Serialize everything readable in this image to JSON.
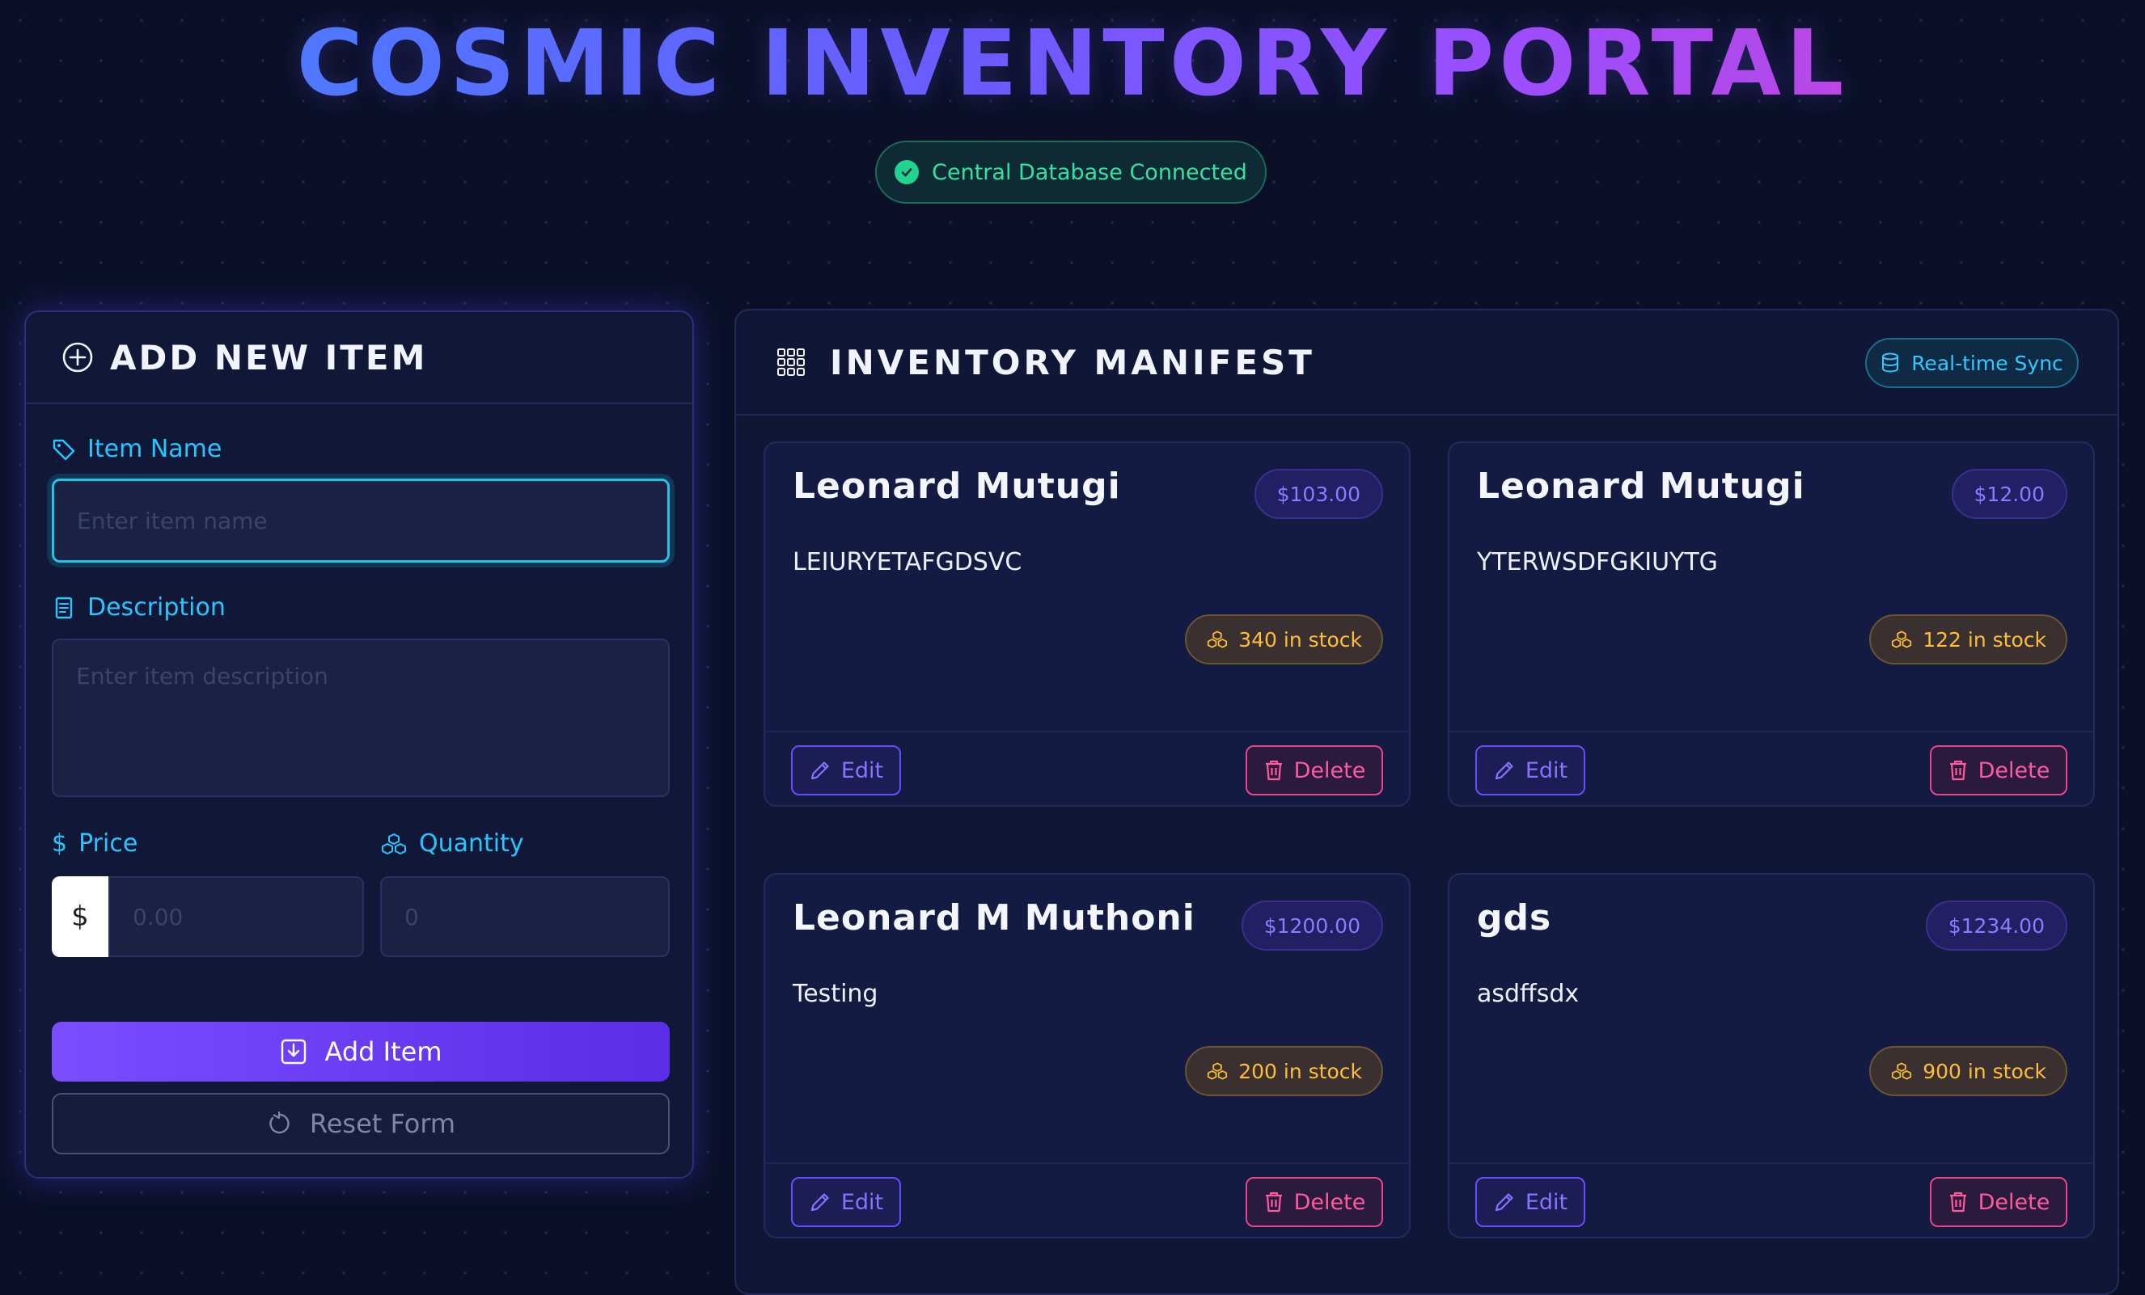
{
  "header": {
    "title": "COSMIC INVENTORY PORTAL",
    "status": "Central Database Connected"
  },
  "add_panel": {
    "title": "ADD NEW ITEM",
    "item_name_label": "Item Name",
    "item_name_placeholder": "Enter item name",
    "description_label": "Description",
    "description_placeholder": "Enter item description",
    "price_label": "Price",
    "price_prefix": "$",
    "price_placeholder": "0.00",
    "quantity_label": "Quantity",
    "quantity_placeholder": "0",
    "add_button": "Add Item",
    "reset_button": "Reset Form"
  },
  "inventory": {
    "title": "INVENTORY MANIFEST",
    "sync_badge": "Real-time Sync",
    "edit_label": "Edit",
    "delete_label": "Delete",
    "items": [
      {
        "name": "Leonard Mutugi",
        "price": "$103.00",
        "description": "LEIURYETAFGDSVC",
        "stock": "340 in stock"
      },
      {
        "name": "Leonard Mutugi",
        "price": "$12.00",
        "description": "YTERWSDFGKIUYTG",
        "stock": "122 in stock"
      },
      {
        "name": "Leonard M Muthoni",
        "price": "$1200.00",
        "description": "Testing",
        "stock": "200 in stock"
      },
      {
        "name": "gds",
        "price": "$1234.00",
        "description": "asdffsdx",
        "stock": "900 in stock"
      }
    ]
  },
  "colors": {
    "background": "#0b1028",
    "accent_cyan": "#27c6ff",
    "accent_purple": "#7a4dff",
    "success": "#34e2a0",
    "stock_amber": "#ffbe3a",
    "delete_pink": "#ff5aa0"
  }
}
